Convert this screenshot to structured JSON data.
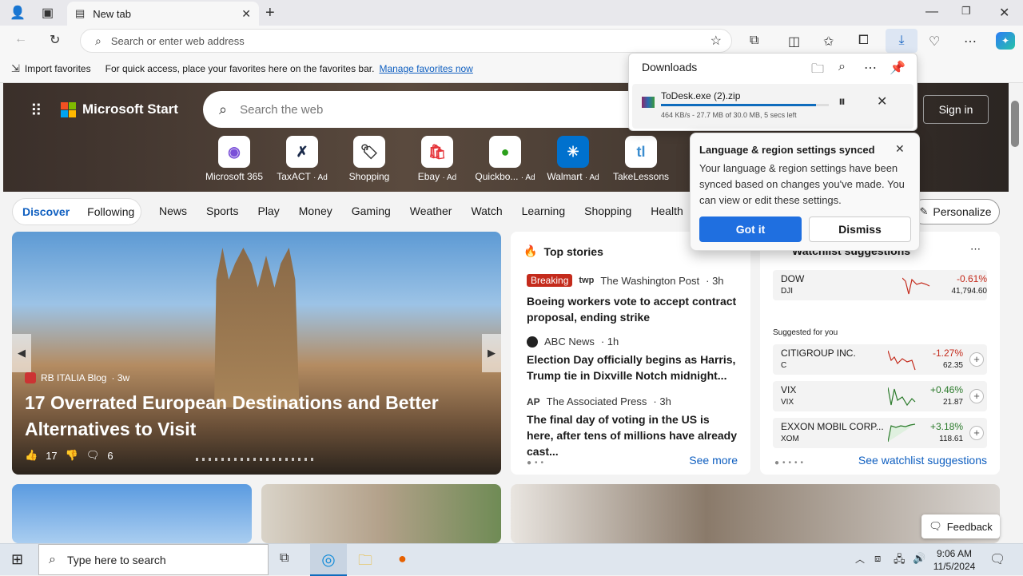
{
  "browser": {
    "tab_title": "New tab",
    "address_placeholder": "Search or enter web address",
    "import_favorites": "Import favorites",
    "favorites_hint": "For quick access, place your favorites here on the favorites bar.",
    "manage_favorites": "Manage favorites now"
  },
  "downloads": {
    "title": "Downloads",
    "file_name": "ToDesk.exe (2).zip",
    "status": "464 KB/s - 27.7 MB of 30.0 MB, 5 secs left",
    "progress": 0.923
  },
  "popup": {
    "title": "Language & region settings synced",
    "body": "Your language & region settings have been synced based on changes you've made. You can view or edit these settings.",
    "got_it": "Got it",
    "dismiss": "Dismiss"
  },
  "msn": {
    "brand": "Microsoft Start",
    "search_placeholder": "Search the web",
    "sign_in": "Sign in",
    "quick_links": [
      {
        "label": "Microsoft 365",
        "ad": ""
      },
      {
        "label": "TaxACT",
        "ad": "· Ad"
      },
      {
        "label": "Shopping",
        "ad": ""
      },
      {
        "label": "Ebay",
        "ad": "· Ad"
      },
      {
        "label": "Quickbo...",
        "ad": "· Ad"
      },
      {
        "label": "Walmart",
        "ad": "· Ad"
      },
      {
        "label": "TakeLessons",
        "ad": ""
      }
    ],
    "nav_pill": [
      "Discover",
      "Following"
    ],
    "nav": [
      "News",
      "Sports",
      "Play",
      "Money",
      "Gaming",
      "Weather",
      "Watch",
      "Learning",
      "Shopping",
      "Health"
    ],
    "personalize": "Personalize",
    "hero": {
      "source": "RB ITALIA Blog",
      "age": "· 3w",
      "title": "17 Overrated European Destinations and Better Alternatives to Visit",
      "likes": "17",
      "comments": "6"
    },
    "top_stories": {
      "title": "Top stories",
      "see_more": "See more",
      "items": [
        {
          "badge": "Breaking",
          "source": "The Washington Post",
          "age": "· 3h",
          "headline": "Boeing workers vote to accept contract proposal, ending strike"
        },
        {
          "badge": "",
          "source": "ABC News",
          "age": "· 1h",
          "headline": "Election Day officially begins as Harris, Trump tie in Dixville Notch midnight..."
        },
        {
          "badge": "",
          "source": "The Associated Press",
          "age": "· 3h",
          "headline": "The final day of voting in the US is here, after tens of millions have already cast..."
        }
      ]
    },
    "watchlist": {
      "title": "Watchlist suggestions",
      "suggested": "Suggested for you",
      "see_all": "See watchlist suggestions",
      "dow": {
        "name": "DOW",
        "symbol": "DJI",
        "change": "-0.61%",
        "value": "41,794.60"
      },
      "stocks": [
        {
          "name": "CITIGROUP INC.",
          "symbol": "C",
          "change": "-1.27%",
          "value": "62.35",
          "dir": "down"
        },
        {
          "name": "VIX",
          "symbol": "VIX",
          "change": "+0.46%",
          "value": "21.87",
          "dir": "up"
        },
        {
          "name": "EXXON MOBIL CORP...",
          "symbol": "XOM",
          "change": "+3.18%",
          "value": "118.61",
          "dir": "up"
        }
      ]
    },
    "feedback": "Feedback"
  },
  "taskbar": {
    "search_placeholder": "Type here to search",
    "time": "9:06 AM",
    "date": "11/5/2024"
  }
}
